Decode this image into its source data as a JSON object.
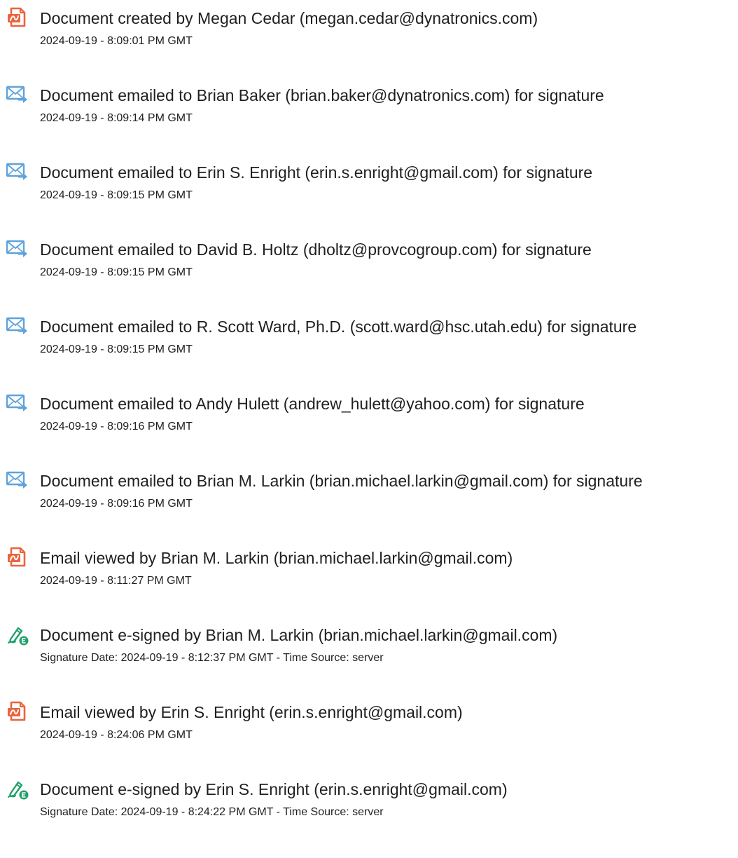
{
  "colors": {
    "created": "#e8653f",
    "emailed": "#5fa3dc",
    "signed": "#22a06b",
    "text": "#1f1f1f"
  },
  "events": [
    {
      "icon": "document-created-icon",
      "title": "Document created by Megan Cedar (megan.cedar@dynatronics.com)",
      "date": "2024-09-19 - 8:09:01 PM GMT"
    },
    {
      "icon": "email-sent-icon",
      "title": "Document emailed to Brian Baker (brian.baker@dynatronics.com) for signature",
      "date": "2024-09-19 - 8:09:14 PM GMT"
    },
    {
      "icon": "email-sent-icon",
      "title": "Document emailed to Erin S. Enright (erin.s.enright@gmail.com) for signature",
      "date": "2024-09-19 - 8:09:15 PM GMT"
    },
    {
      "icon": "email-sent-icon",
      "title": "Document emailed to David B. Holtz (dholtz@provcogroup.com) for signature",
      "date": "2024-09-19 - 8:09:15 PM GMT"
    },
    {
      "icon": "email-sent-icon",
      "title": "Document emailed to R. Scott Ward, Ph.D. (scott.ward@hsc.utah.edu) for signature",
      "date": "2024-09-19 - 8:09:15 PM GMT"
    },
    {
      "icon": "email-sent-icon",
      "title": "Document emailed to Andy Hulett (andrew_hulett@yahoo.com) for signature",
      "date": "2024-09-19 - 8:09:16 PM GMT"
    },
    {
      "icon": "email-sent-icon",
      "title": "Document emailed to Brian M. Larkin (brian.michael.larkin@gmail.com) for signature",
      "date": "2024-09-19 - 8:09:16 PM GMT"
    },
    {
      "icon": "document-viewed-icon",
      "title": "Email viewed by Brian M. Larkin (brian.michael.larkin@gmail.com)",
      "date": "2024-09-19 - 8:11:27 PM GMT"
    },
    {
      "icon": "e-signature-icon",
      "title": "Document e-signed by Brian M. Larkin (brian.michael.larkin@gmail.com)",
      "date": "Signature Date: 2024-09-19 - 8:12:37 PM GMT - Time Source: server"
    },
    {
      "icon": "document-viewed-icon",
      "title": "Email viewed by Erin S. Enright (erin.s.enright@gmail.com)",
      "date": "2024-09-19 - 8:24:06 PM GMT"
    },
    {
      "icon": "e-signature-icon",
      "title": "Document e-signed by Erin S. Enright (erin.s.enright@gmail.com)",
      "date": "Signature Date: 2024-09-19 - 8:24:22 PM GMT - Time Source: server"
    }
  ]
}
